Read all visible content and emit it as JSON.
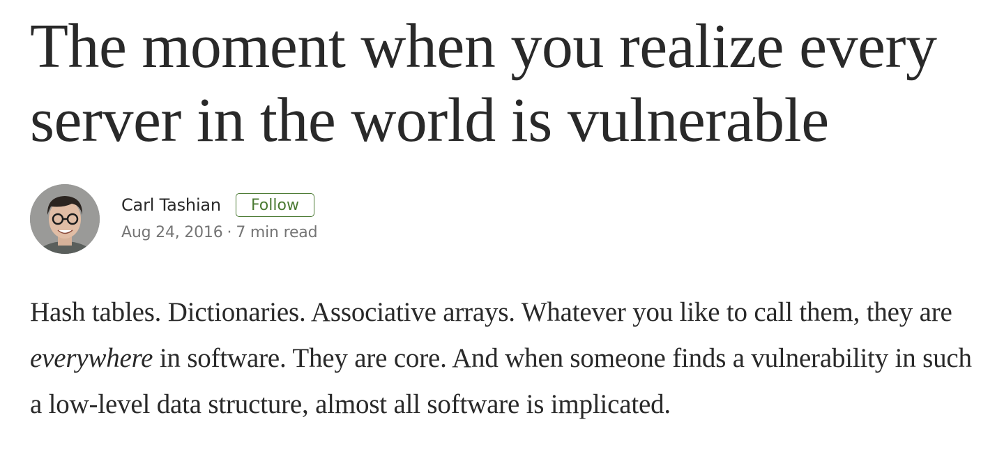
{
  "article": {
    "title": "The moment when you realize every server in the world is vulnerable",
    "author": {
      "name": "Carl Tashian",
      "follow_label": "Follow",
      "avatar_icon": "author-avatar"
    },
    "meta": {
      "date": "Aug 24, 2016",
      "separator": "·",
      "read_time": "7 min read"
    },
    "body": {
      "part1": "Hash tables. Dictionaries. Associative arrays. Whatever you like to call them, they are ",
      "emphasis": "everywhere",
      "part2": " in software. They are core. And when someone finds a vulnerability in such a low-level data structure, almost all software is implicated."
    },
    "colors": {
      "text": "#292929",
      "muted": "#757575",
      "follow_accent": "#4b7a33"
    }
  }
}
